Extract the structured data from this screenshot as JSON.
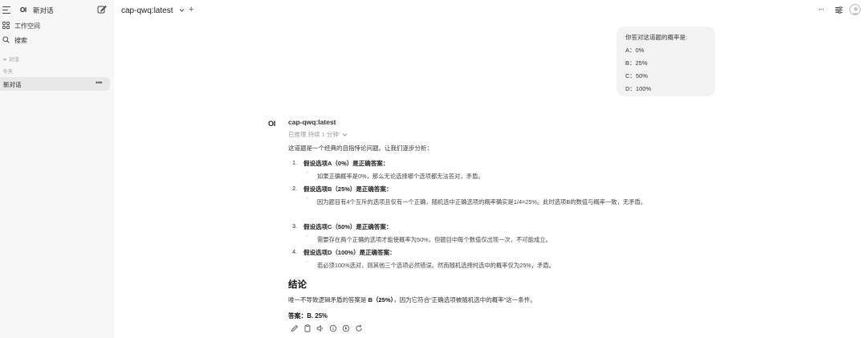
{
  "sidebar": {
    "logo": "OI",
    "new_chat_label": "新对话",
    "workspace_label": "工作空间",
    "search_label": "搜索",
    "section_label": "对话",
    "today_label": "今天",
    "chat_item_label": "新对话",
    "chat_item_menu": "•••"
  },
  "header": {
    "model_name": "cap-qwq:latest",
    "plus": "+",
    "more": "···"
  },
  "user_message": {
    "lines": [
      "你答对这道题的概率是:",
      "A：0%",
      "B：25%",
      "C：50%",
      "D：100%"
    ]
  },
  "assistant": {
    "logo": "OI",
    "name": "cap-qwq:latest",
    "reasoned": "已推理 持续 1 分钟",
    "intro": "这道题是一个经典的自指悖论问题。让我们逐步分析：",
    "items": [
      {
        "num": "1.",
        "heading": "假设选项A（0%）是正确答案",
        "colon": "：",
        "detail": "如果正确概率是0%，那么无论选择哪个选项都无法答对，矛盾。"
      },
      {
        "num": "2.",
        "heading": "假设选项B（25%）是正确答案",
        "colon": "：",
        "detail": "因为题目有4个互斥的选项且仅有一个正确，随机选中正确选项的概率确实是1/4=25%。此时选项B的数值与概率一致，无矛盾。"
      },
      {
        "num": "3.",
        "heading": "假设选项C（50%）是正确答案",
        "colon": "：",
        "detail": "需要存在两个正确的选项才能使概率为50%，但题目中每个数值仅出现一次，不可能成立。"
      },
      {
        "num": "4.",
        "heading": "假设选项D（100%）是正确答案",
        "colon": "：",
        "detail": "若必须100%选对，则其他三个选项必然错误。然而随机选择时选中的概率仅为25%，矛盾。"
      }
    ],
    "conclusion_title": "结论",
    "conclusion_pre": "唯一不导致逻辑矛盾的答案是 ",
    "conclusion_bold": "B（25%）",
    "conclusion_post": "，因为它符合“正确选项被随机选中的概率”这一条件。",
    "answer": "答案：B. 25%"
  },
  "colors": {
    "sidebar_bg": "#f7f7f7",
    "selected_chat_bg": "#e8e8e8",
    "bubble_bg": "#f3f3f3",
    "muted_text": "#9a9a9a"
  },
  "icons": [
    "menu-icon",
    "compose-icon",
    "workspace-grid-icon",
    "search-icon",
    "chevron-down-icon",
    "plus-icon",
    "more-icon",
    "tune-icon",
    "avatar-icon",
    "edit-icon",
    "copy-icon",
    "speaker-icon",
    "info-icon",
    "continue-icon",
    "regenerate-icon"
  ]
}
